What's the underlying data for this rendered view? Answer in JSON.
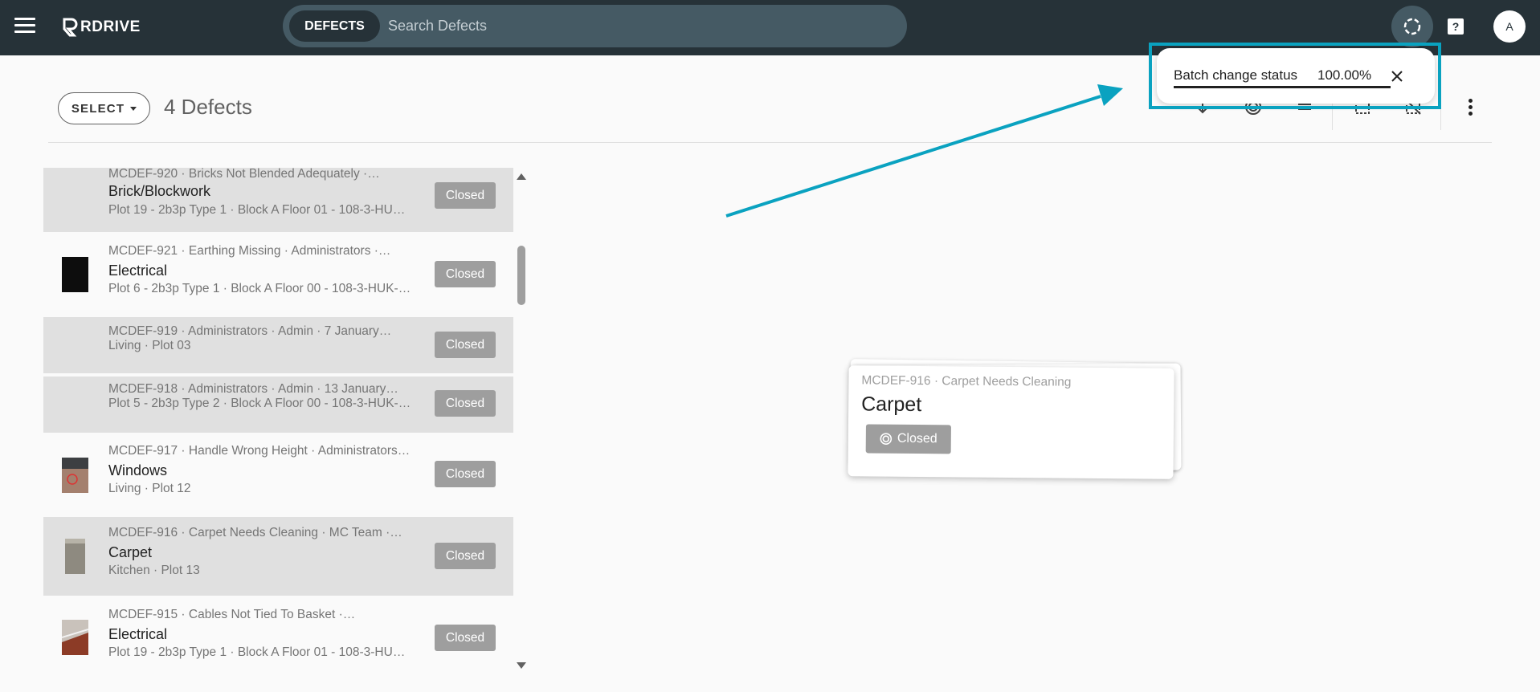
{
  "app": {
    "logo_text": "RDRIVE"
  },
  "search": {
    "chip_label": "DEFECTS",
    "placeholder": "Search Defects"
  },
  "user": {
    "avatar_initial": "A"
  },
  "header": {
    "select_label": "SELECT",
    "count_title": "4 Defects"
  },
  "snackbar": {
    "label": "Batch change status",
    "percent_text": "100.00%",
    "progress": 1.0
  },
  "list": {
    "items": [
      {
        "meta": "MCDEF-920 · Bricks Not Blended Adequately ·…",
        "title": "Brick/Blockwork",
        "sub": "Plot 19 - 2b3p Type 1 · Block A Floor 01 - 108-3-HU…",
        "status": "Closed",
        "selected": true,
        "thumb": "none"
      },
      {
        "meta": "MCDEF-921 · Earthing Missing · Administrators ·…",
        "title": "Electrical",
        "sub": "Plot 6 - 2b3p Type 1 · Block A Floor 00 - 108-3-HUK-…",
        "status": "Closed",
        "selected": false,
        "thumb": "dark"
      },
      {
        "meta": "MCDEF-919 · Administrators · Admin · 7 January…",
        "title": "",
        "sub": "Living · Plot 03",
        "status": "Closed",
        "selected": true,
        "thumb": "none"
      },
      {
        "meta": "MCDEF-918 · Administrators · Admin · 13 January…",
        "title": "",
        "sub": "Plot 5 - 2b3p Type 2 · Block A Floor 00 - 108-3-HUK-…",
        "status": "Closed",
        "selected": true,
        "thumb": "none"
      },
      {
        "meta": "MCDEF-917 · Handle Wrong Height · Administrators…",
        "title": "Windows",
        "sub": "Living · Plot 12",
        "status": "Closed",
        "selected": false,
        "thumb": "window"
      },
      {
        "meta": "MCDEF-916 · Carpet Needs Cleaning · MC Team ·…",
        "title": "Carpet",
        "sub": "Kitchen · Plot 13",
        "status": "Closed",
        "selected": true,
        "thumb": "carpet"
      },
      {
        "meta": "MCDEF-915 · Cables Not Tied To Basket ·…",
        "title": "Electrical",
        "sub": "Plot 19 - 2b3p Type 1 · Block A Floor 01 - 108-3-HU…",
        "status": "Closed",
        "selected": false,
        "thumb": "cables"
      }
    ]
  },
  "drag_card": {
    "meta": "MCDEF-916 · Carpet Needs Cleaning",
    "title": "Carpet",
    "status": "Closed"
  },
  "colors": {
    "topbar": "#263238",
    "search_bg": "#455a64",
    "chip_grey": "#9e9e9e",
    "selected_row": "#e0e0e0",
    "annotation": "#0aa2c0"
  }
}
